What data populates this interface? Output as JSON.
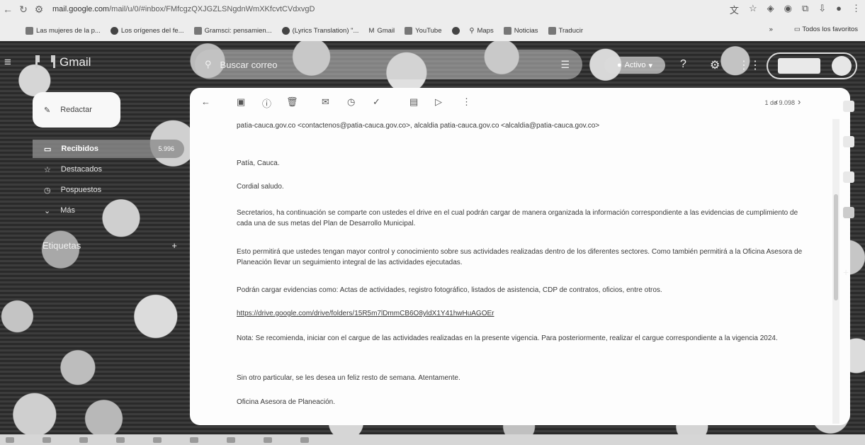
{
  "browser": {
    "url_prefix": "mail.google.com",
    "url_rest": "/mail/u/0/#inbox/FMfcgzQXJGZLSNgdnWmXKfcvtCVdxvgD",
    "bookmarks": [
      "Las mujeres de la p...",
      "Los orígenes del fe...",
      "Gramsci: pensamien...",
      "(Lyrics Translation) \"...",
      "Gmail",
      "YouTube",
      "Maps",
      "Noticias",
      "Traducir"
    ],
    "all_bookmarks": "Todos los favoritos",
    "more": "»"
  },
  "gmail": {
    "app_name": "Gmail",
    "search_placeholder": "Buscar correo",
    "status": "Activo",
    "compose_label": "Redactar",
    "nav": [
      {
        "label": "Recibidos",
        "count": "5.996"
      },
      {
        "label": "Destacados",
        "count": ""
      },
      {
        "label": "Pospuestos",
        "count": ""
      },
      {
        "label": "Más",
        "count": ""
      }
    ],
    "labels_heading": "Etiquetas",
    "labels_add": "+"
  },
  "message": {
    "pager": "1 de 9.098",
    "recipients_line": "patia-cauca.gov.co <contactenos@patia-cauca.gov.co>, alcaldia patia-cauca.gov.co <alcaldia@patia-cauca.gov.co>",
    "paragraphs": [
      "Patía, Cauca.",
      "Cordial saludo.",
      "Secretarios, ha continuación se comparte con ustedes el drive en el cual podrán cargar de manera organizada la información correspondiente a las evidencias de cumplimiento de cada una de sus metas del Plan de Desarrollo Municipal.",
      "Esto permitirá que ustedes tengan mayor control y conocimiento sobre sus actividades realizadas dentro de los diferentes sectores. Como también permitirá a la Oficina Asesora de Planeación llevar un seguimiento integral de las actividades ejecutadas.",
      "Podrán cargar evidencias como: Actas de actividades, registro fotográfico, listados de asistencia, CDP de contratos, oficios, entre otros.",
      "https://drive.google.com/drive/folders/15R5m7lDmmCB6O8yldX1Y41hwHuAGOEr",
      "Nota: Se recomienda, iniciar con el cargue de las actividades realizadas en la presente vigencia. Para posteriormente, realizar el cargue correspondiente a la vigencia 2024.",
      "Sin otro particular, se les desea un feliz resto de semana. Atentamente.",
      "Oficina Asesora de Planeación."
    ]
  },
  "icons": [
    "back-arrow-icon",
    "archive-icon",
    "report-spam-icon",
    "delete-icon",
    "mark-unread-icon",
    "snooze-icon",
    "add-task-icon",
    "move-to-icon",
    "label-icon",
    "more-vert-icon"
  ]
}
